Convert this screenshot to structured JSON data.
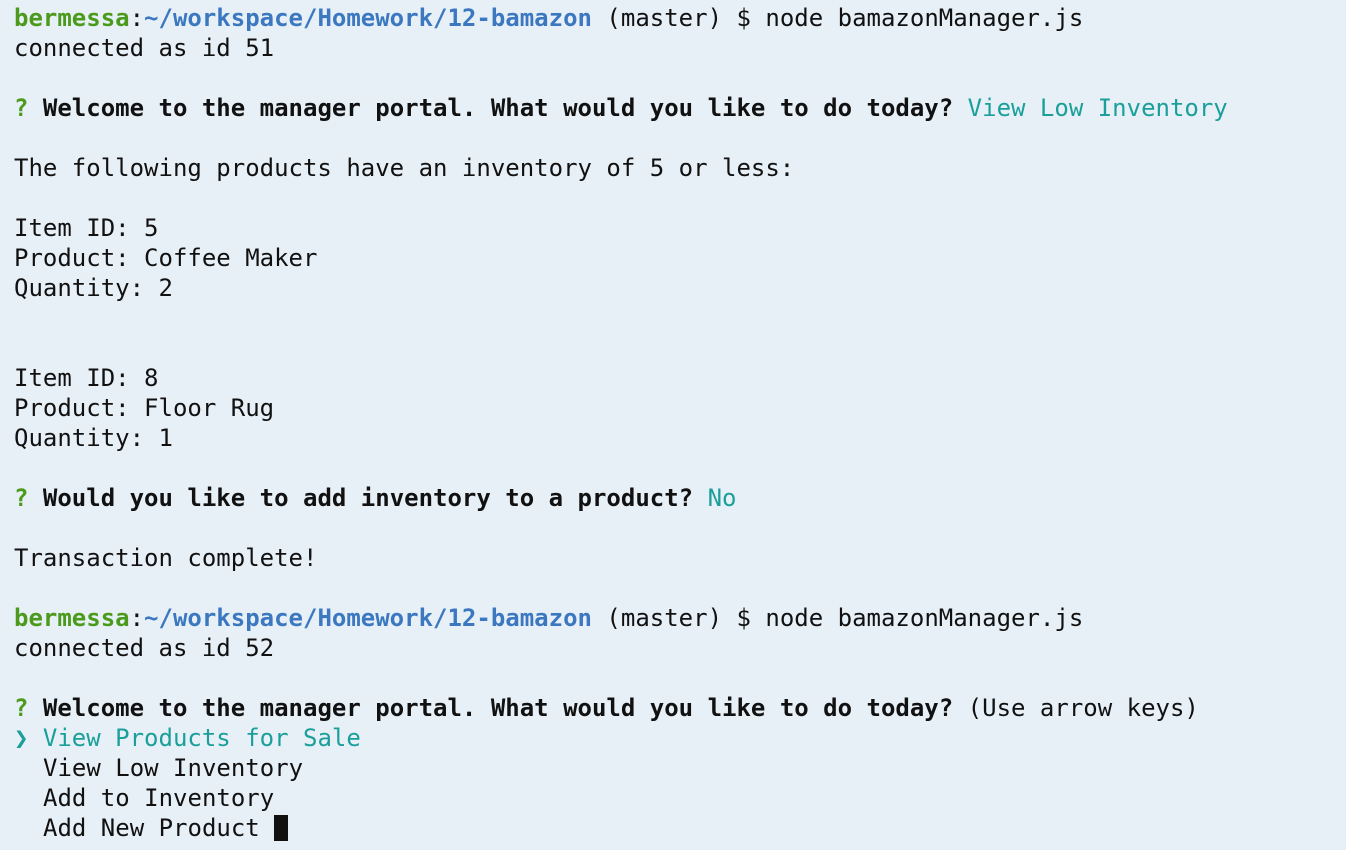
{
  "colors": {
    "background": "#e8f0f7",
    "text": "#111111",
    "user": "#4b9a1c",
    "path": "#3b78c0",
    "answer": "#1a9f9a",
    "question_mark": "#4b9a1c"
  },
  "session1": {
    "prompt": {
      "user": "bermessa",
      "colon": ":",
      "path": "~/workspace/Homework/12-bamazon",
      "branch": " (master)",
      "dollar": " $ ",
      "command": "node bamazonManager.js"
    },
    "connected": "connected as id 51",
    "question": {
      "mark": "?",
      "text": "Welcome to the manager portal. What would you like to do today?",
      "answer": "View Low Inventory"
    },
    "low_inventory_header": "The following products have an inventory of 5 or less:",
    "items": [
      {
        "id_line": "Item ID: 5",
        "product_line": "Product: Coffee Maker",
        "quantity_line": "Quantity: 2"
      },
      {
        "id_line": "Item ID: 8",
        "product_line": "Product: Floor Rug",
        "quantity_line": "Quantity: 1"
      }
    ],
    "add_question": {
      "mark": "?",
      "text": "Would you like to add inventory to a product?",
      "answer": "No"
    },
    "complete": "Transaction complete!"
  },
  "session2": {
    "prompt": {
      "user": "bermessa",
      "colon": ":",
      "path": "~/workspace/Homework/12-bamazon",
      "branch": " (master)",
      "dollar": " $ ",
      "command": "node bamazonManager.js"
    },
    "connected": "connected as id 52",
    "question": {
      "mark": "?",
      "text": "Welcome to the manager portal. What would you like to do today?",
      "hint": "(Use arrow keys)"
    },
    "pointer": "❯",
    "menu": [
      "View Products for Sale",
      "View Low Inventory",
      "Add to Inventory",
      "Add New Product"
    ]
  }
}
